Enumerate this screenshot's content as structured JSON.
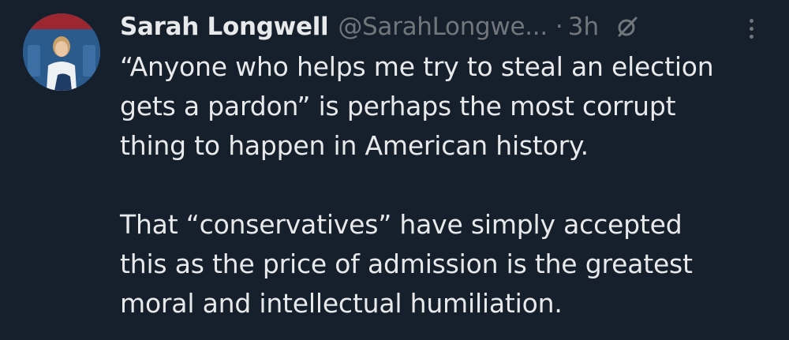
{
  "tweet": {
    "author_name": "Sarah Longwell",
    "author_handle": "@SarahLongwe...",
    "separator": "·",
    "timestamp": "3h",
    "icons": {
      "avatar": "avatar",
      "grok": "grok-icon",
      "more": "more-icon"
    },
    "paragraphs": [
      [
        "“Anyone who helps me try to steal an election",
        "gets a pardon” is perhaps the most corrupt",
        "thing to happen in American history."
      ],
      [
        "That “conservatives” have simply accepted",
        "this as the price of admission is the greatest",
        "moral and intellectual humiliation."
      ]
    ]
  },
  "colors": {
    "background": "#16202c",
    "text_primary": "#e7e9ea",
    "text_secondary": "#71767b"
  }
}
